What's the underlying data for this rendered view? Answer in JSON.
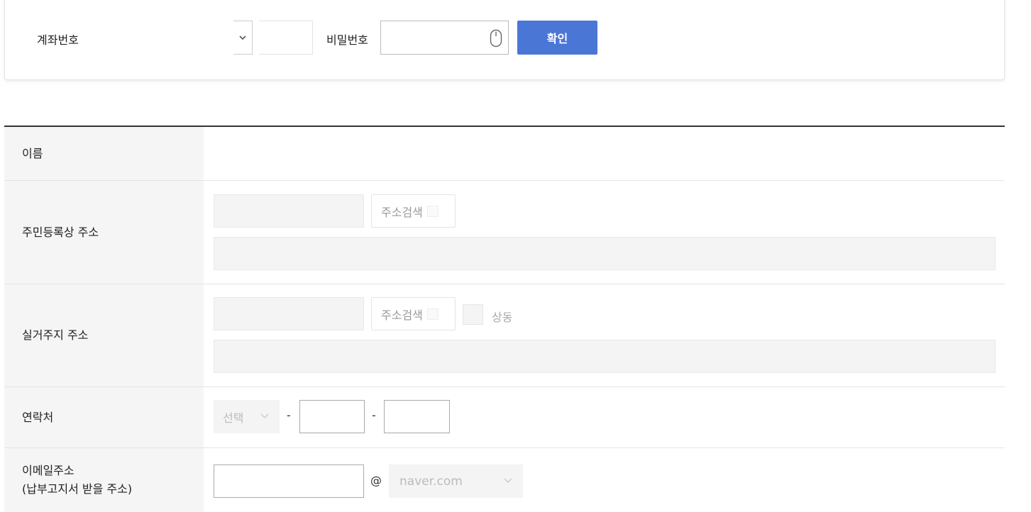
{
  "account": {
    "label": "계좌번호",
    "password_label": "비밀번호",
    "confirm_label": "확인"
  },
  "form": {
    "name_label": "이름",
    "resident_address_label": "주민등록상 주소",
    "search_address_label": "주소검색",
    "real_address_label": "실거주지 주소",
    "same_label": "상동",
    "phone_label": "연락처",
    "phone_select_value": "선택",
    "dash": "-",
    "email_label_line1": "이메일주소",
    "email_label_line2": "(납부고지서 받을 주소)",
    "email_at": "@",
    "email_domain_value": "naver.com"
  },
  "icons": {
    "chevron": "chevron-down-icon",
    "mouse": "mouse-icon"
  },
  "colors": {
    "accent": "#4a76d6"
  }
}
